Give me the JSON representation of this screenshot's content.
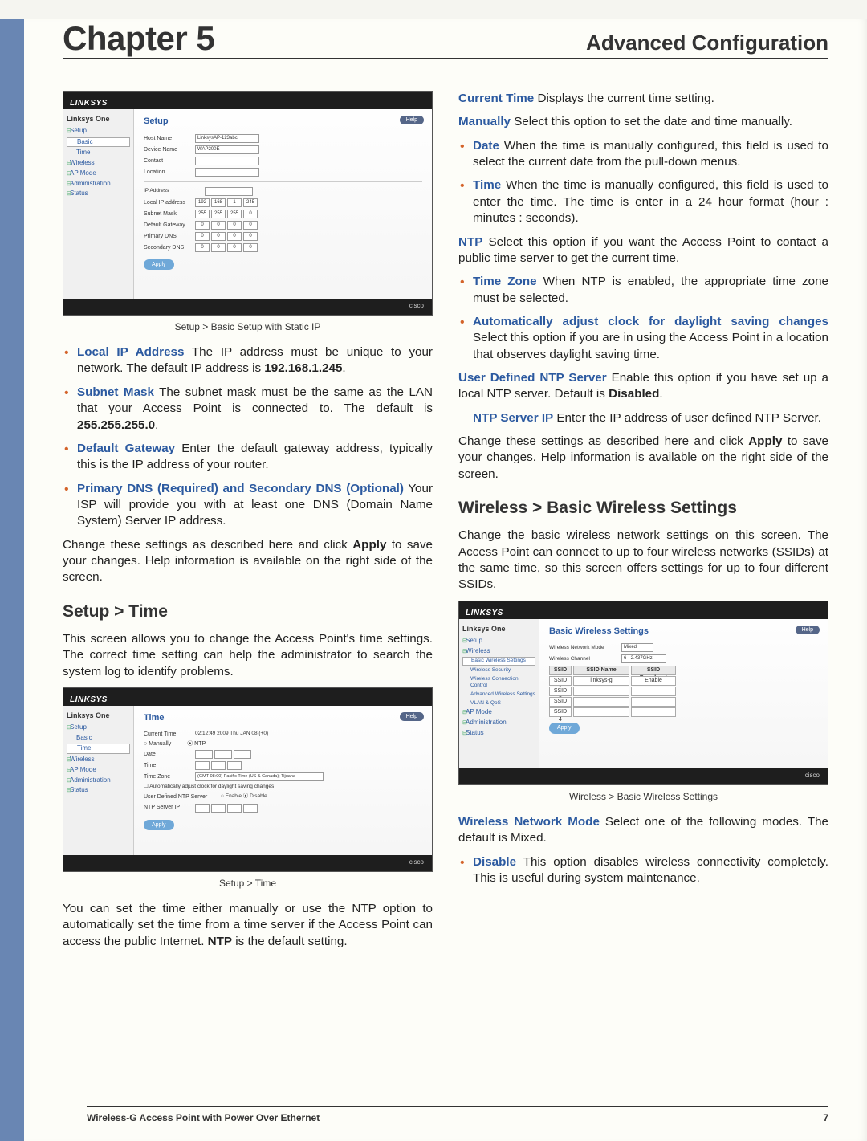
{
  "header": {
    "chapter": "Chapter 5",
    "title": "Advanced Configuration"
  },
  "left_column": {
    "caption1": "Setup > Basic Setup with Static IP",
    "bullets1": [
      {
        "label": "Local IP Address",
        "text": "The IP address must be unique to your network. The default IP address is ",
        "bold_tail": "192.168.1.245",
        "tail": "."
      },
      {
        "label": "Subnet Mask",
        "text": "The subnet mask must be the same as the LAN that your Access Point is connected to. The default is ",
        "bold_tail": "255.255.255.0",
        "tail": "."
      },
      {
        "label": "Default Gateway",
        "text": "Enter the default gateway address, typically this is the IP address of your router."
      },
      {
        "label": "Primary DNS (Required) and Secondary DNS (Optional)",
        "text": "Your ISP will provide you with at least one DNS (Domain Name System) Server IP address."
      }
    ],
    "para1a": "Change these settings as described here and click ",
    "para1b": "Apply",
    "para1c": " to save your changes. Help information is available on the right side of the screen.",
    "section1": "Setup > Time",
    "para2": "This screen allows you to change the Access Point's time settings. The correct time setting can help the administrator to search the system log to identify problems.",
    "caption2": "Setup > Time",
    "para3a": "You can set the time either manually or use the NTP option to automatically set the time from a time server if the Access Point can access the public Internet. ",
    "para3b": "NTP",
    "para3c": " is the default setting."
  },
  "right_column": {
    "r1_label": "Current Time",
    "r1_text": "Displays the current time setting.",
    "r2_label": "Manually",
    "r2_text": "Select this option to set the date and time manually.",
    "bullets_manual": [
      {
        "label": "Date",
        "text": "When the time is manually configured, this field is used to select the current date from the pull-down menus."
      },
      {
        "label": "Time",
        "text": "When the time is manually configured, this field is used to enter the time. The time is enter in a 24 hour format (hour : minutes : seconds)."
      }
    ],
    "r3_label": "NTP",
    "r3_text": "Select this option if you want the Access Point to contact a public time server to get the current time.",
    "bullets_ntp": [
      {
        "label": "Time Zone",
        "text": "When NTP is enabled, the appropriate time zone must be selected."
      },
      {
        "label": "Automatically adjust clock for daylight saving changes",
        "text": "Select this option if you are in using the Access Point in a location that observes daylight saving time."
      }
    ],
    "r4_label": "User Defined NTP Server",
    "r4_text_a": "Enable this option if you have set up a local NTP server. Default is ",
    "r4_text_b": "Disabled",
    "r4_text_c": ".",
    "r5_label": "NTP Server IP",
    "r5_text": "Enter the IP address of user defined NTP Server.",
    "para_apply_a": "Change these settings as described here and click ",
    "para_apply_b": "Apply",
    "para_apply_c": " to save your changes. Help information is available on the right side of the screen.",
    "section2": "Wireless > Basic Wireless Settings",
    "para4": "Change the basic wireless network settings on this screen. The Access Point can connect to up to four wireless networks (SSIDs) at the same time, so this screen offers settings for up to four different SSIDs.",
    "caption3": "Wireless > Basic Wireless Settings",
    "r6_label": "Wireless Network Mode",
    "r6_text": "Select one of the following modes. The default is Mixed.",
    "bullets_mode": [
      {
        "label": "Disable",
        "text": "This option disables wireless connectivity completely. This is useful during system maintenance."
      }
    ]
  },
  "screenshots": {
    "brand": "LINKSYS",
    "sidebar_title": "Linksys One",
    "cisco": "cisco",
    "help": "Help",
    "apply": "Apply",
    "s1": {
      "heading": "Setup",
      "nav": [
        "Setup",
        "Basic",
        "Time",
        "Wireless",
        "AP Mode",
        "Administration",
        "Status"
      ],
      "rows_top": [
        "Host Name",
        "Device Name",
        "Contact",
        "Location"
      ],
      "ip_section_label": "IP Address",
      "ip_rows": [
        "Local IP address",
        "Subnet Mask",
        "Default Gateway",
        "Primary DNS",
        "Secondary DNS"
      ],
      "host_val": "LinksysAP-123abc",
      "device_val": "WAP200E"
    },
    "s2": {
      "heading": "Time",
      "nav": [
        "Setup",
        "Basic",
        "Time",
        "Wireless",
        "AP Mode",
        "Administration",
        "Status"
      ],
      "current_time_label": "Current Time",
      "current_time_val": "02:12:49 2009 Thu JAN 08 (+0)",
      "manually": "Manually",
      "ntp": "NTP",
      "date": "Date",
      "time": "Time",
      "tz": "Time Zone",
      "tz_val": "(GMT-08:00) Pacific Time (US & Canada); Tijuana",
      "auto_dst": "Automatically adjust clock for daylight saving changes",
      "user_ntp": "User Defined NTP Server",
      "enable": "Enable",
      "disable": "Disable",
      "ntp_ip": "NTP Server IP"
    },
    "s3": {
      "heading": "Basic Wireless Settings",
      "nav": [
        "Setup",
        "Wireless",
        "Basic Wireless Settings",
        "Wireless Security",
        "Wireless Connection Control",
        "Advanced Wireless Settings",
        "VLAN & QoS",
        "AP Mode",
        "Administration",
        "Status"
      ],
      "mode_label": "Wireless Network Mode",
      "mode_val": "Mixed",
      "channel_label": "Wireless Channel",
      "channel_val": "6 - 2.437GHz",
      "table_headers": [
        "SSID",
        "SSID Name",
        "SSID Broadcast"
      ],
      "ssids": [
        "SSID 1",
        "SSID 2",
        "SSID 3",
        "SSID 4"
      ],
      "ssid1_name": "linksys-g",
      "enable": "Enable"
    }
  },
  "footer": {
    "product": "Wireless-G Access Point with  Power Over Ethernet",
    "page": "7"
  }
}
